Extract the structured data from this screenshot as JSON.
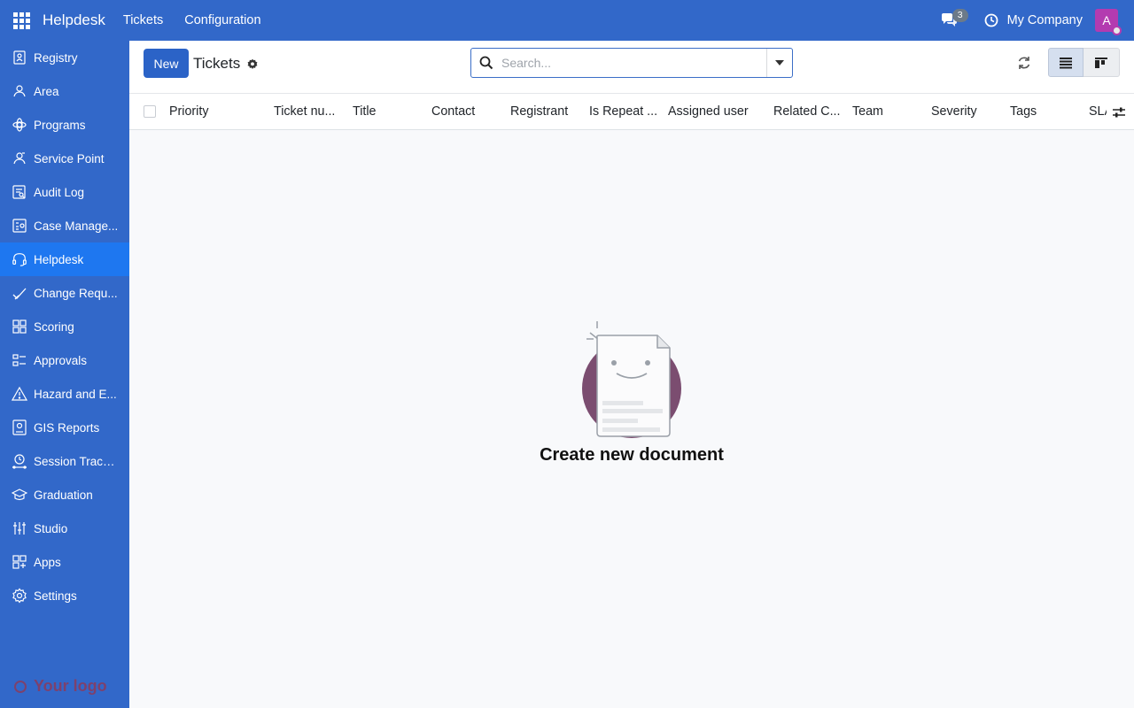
{
  "app": {
    "brand": "Helpdesk"
  },
  "topbar": {
    "menu": [
      "Tickets",
      "Configuration"
    ],
    "message_count": "3",
    "company": "My Company",
    "avatar_initial": "A"
  },
  "sidebar": {
    "items": [
      {
        "label": "Registry",
        "icon": "registry-icon"
      },
      {
        "label": "Area",
        "icon": "area-icon"
      },
      {
        "label": "Programs",
        "icon": "programs-icon"
      },
      {
        "label": "Service Point",
        "icon": "service-point-icon"
      },
      {
        "label": "Audit Log",
        "icon": "audit-log-icon"
      },
      {
        "label": "Case Manage...",
        "icon": "case-management-icon"
      },
      {
        "label": "Helpdesk",
        "icon": "headset-icon",
        "active": true
      },
      {
        "label": "Change Requ...",
        "icon": "change-request-icon"
      },
      {
        "label": "Scoring",
        "icon": "scoring-icon"
      },
      {
        "label": "Approvals",
        "icon": "approvals-icon"
      },
      {
        "label": "Hazard and E...",
        "icon": "hazard-icon"
      },
      {
        "label": "GIS Reports",
        "icon": "gis-reports-icon"
      },
      {
        "label": "Session Tracki...",
        "icon": "session-tracking-icon"
      },
      {
        "label": "Graduation",
        "icon": "graduation-icon"
      },
      {
        "label": "Studio",
        "icon": "studio-icon"
      },
      {
        "label": "Apps",
        "icon": "apps-icon"
      },
      {
        "label": "Settings",
        "icon": "settings-icon"
      }
    ],
    "logo_text": "Your logo"
  },
  "control": {
    "new_label": "New",
    "title": "Tickets",
    "search_placeholder": "Search..."
  },
  "table": {
    "columns": [
      "Priority",
      "Ticket nu...",
      "Title",
      "Contact",
      "Registrant",
      "Is Repeat ...",
      "Assigned user",
      "Related C...",
      "Team",
      "Severity",
      "Tags",
      "SLA"
    ]
  },
  "empty_state": {
    "title": "Create new document"
  },
  "colors": {
    "navbar": "#3268c9",
    "sidebar_active": "#1e77f0",
    "primary_button": "#2b63c7",
    "avatar": "#b33bb0"
  }
}
